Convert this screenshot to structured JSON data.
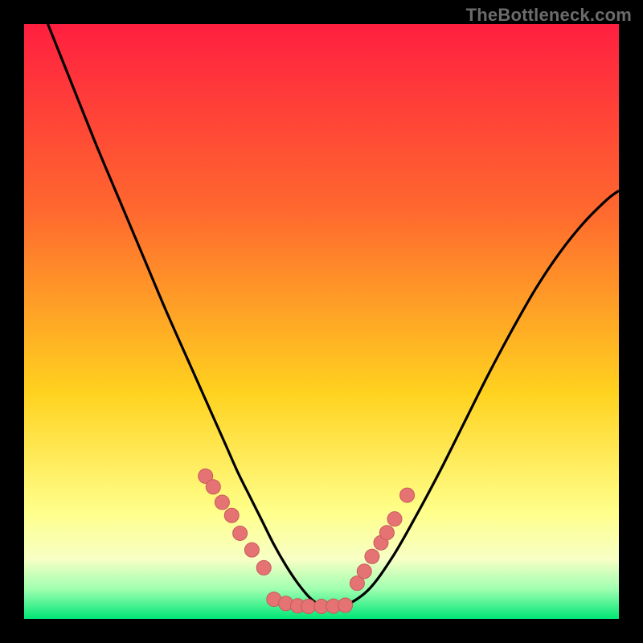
{
  "attribution": "TheBottleneck.com",
  "colors": {
    "background_black": "#000000",
    "grad_top": "#ff1f40",
    "grad_upper_mid": "#ff6a2e",
    "grad_mid": "#ffd21f",
    "grad_lower_mid": "#ffff8a",
    "grad_low_pale": "#f7ffc5",
    "grad_low_mint": "#9fffb0",
    "grad_bottom": "#00e676",
    "curve": "#000000",
    "marker_fill": "#e57373",
    "marker_stroke": "#c85a5a"
  },
  "chart_data": {
    "type": "line",
    "title": "",
    "xlabel": "",
    "ylabel": "",
    "xlim": [
      0,
      100
    ],
    "ylim": [
      0,
      100
    ],
    "grid": false,
    "legend": false,
    "series": [
      {
        "name": "bottleneck-curve",
        "x": [
          0,
          4,
          8,
          12,
          16,
          20,
          24,
          28,
          32,
          34,
          36,
          38,
          40,
          42,
          44,
          46,
          48,
          50,
          52,
          54,
          58,
          62,
          66,
          70,
          74,
          78,
          82,
          86,
          90,
          94,
          98,
          100
        ],
        "y": [
          110,
          100,
          90,
          80,
          70.5,
          61,
          51.5,
          42.5,
          33.5,
          29,
          24.5,
          20.5,
          16.5,
          12.5,
          9,
          6,
          3.6,
          2.2,
          2,
          2.2,
          5,
          10.5,
          17.5,
          25,
          33,
          41,
          48.5,
          55.5,
          61.5,
          66.5,
          70.5,
          72
        ]
      }
    ],
    "markers": [
      {
        "name": "left-cluster",
        "x": [
          30.5,
          31.8,
          33.3,
          34.9,
          36.3,
          38.3,
          40.3
        ],
        "y": [
          24.0,
          22.2,
          19.6,
          17.4,
          14.4,
          11.6,
          8.6
        ]
      },
      {
        "name": "valley-floor",
        "x": [
          42.0,
          44.0,
          46.0,
          47.8,
          50.0,
          52.0,
          54.0
        ],
        "y": [
          3.3,
          2.6,
          2.2,
          2.1,
          2.1,
          2.15,
          2.3
        ]
      },
      {
        "name": "right-cluster",
        "x": [
          56.0,
          57.2,
          58.5,
          60.0,
          61.0,
          62.3,
          64.4
        ],
        "y": [
          6.0,
          8.0,
          10.5,
          12.8,
          14.5,
          16.8,
          20.8
        ]
      }
    ]
  }
}
